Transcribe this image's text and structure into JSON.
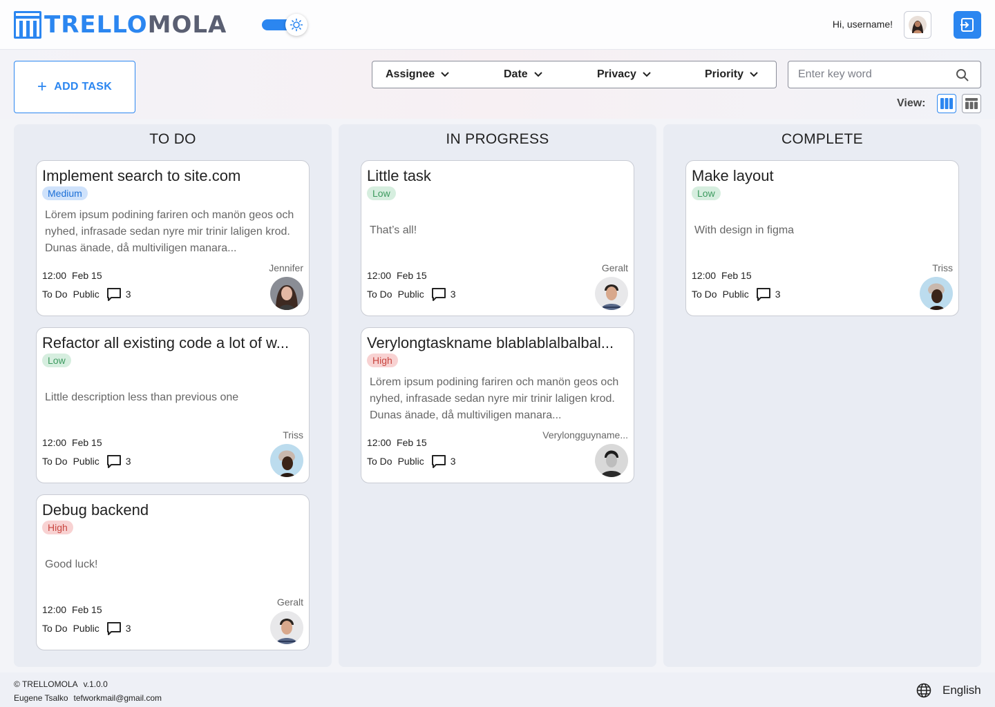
{
  "app": {
    "logo_part1": "TRELLO",
    "logo_part2": "MOLA",
    "greeting": "Hi, username!"
  },
  "colors": {
    "accent": "#2b86f0",
    "medium": "#1c6fd6",
    "low": "#3c9a5f",
    "high": "#c8453f"
  },
  "toolbar": {
    "add_task_label": "ADD TASK",
    "filters": [
      "Assignee",
      "Date",
      "Privacy",
      "Priority"
    ],
    "search_placeholder": "Enter key word",
    "view_label": "View:"
  },
  "columns": [
    {
      "title": "TO DO",
      "cards": [
        {
          "title": "Implement search to site.com",
          "priority": "Medium",
          "description": "Lörem ipsum podining fariren och manön geos och nyhed, infrasade sedan nyre mir trinir laligen krod. Dunas änade, då multiviligen manara...",
          "time": "12:00",
          "date": "Feb 15",
          "status": "To Do",
          "privacy": "Public",
          "comments": "3",
          "assignee": "Jennifer"
        },
        {
          "title": "Refactor all existing code a lot of w...",
          "priority": "Low",
          "description": "Little description less than previous one",
          "time": "12:00",
          "date": "Feb 15",
          "status": "To Do",
          "privacy": "Public",
          "comments": "3",
          "assignee": "Triss"
        },
        {
          "title": "Debug backend",
          "priority": "High",
          "description": "Good luck!",
          "time": "12:00",
          "date": "Feb 15",
          "status": "To Do",
          "privacy": "Public",
          "comments": "3",
          "assignee": "Geralt"
        }
      ]
    },
    {
      "title": "IN PROGRESS",
      "cards": [
        {
          "title": "Little task",
          "priority": "Low",
          "description": "That’s all!",
          "time": "12:00",
          "date": "Feb 15",
          "status": "To Do",
          "privacy": "Public",
          "comments": "3",
          "assignee": "Geralt"
        },
        {
          "title": "Verylongtaskname blablablalbalbal...",
          "priority": "High",
          "description": "Lörem ipsum podining fariren och manön geos och nyhed, infrasade sedan nyre mir trinir laligen krod. Dunas änade, då multiviligen manara...",
          "time": "12:00",
          "date": "Feb 15",
          "status": "To Do",
          "privacy": "Public",
          "comments": "3",
          "assignee": "Verylongguyname..."
        }
      ]
    },
    {
      "title": "COMPLETE",
      "cards": [
        {
          "title": "Make layout",
          "priority": "Low",
          "description": "With design in figma",
          "time": "12:00",
          "date": "Feb 15",
          "status": "To Do",
          "privacy": "Public",
          "comments": "3",
          "assignee": "Triss"
        }
      ]
    }
  ],
  "footer": {
    "copyright": "© TRELLOMOLA",
    "version": "v.1.0.0",
    "author": "Eugene Tsalko",
    "email": "tefworkmail@gmail.com",
    "language": "English"
  }
}
